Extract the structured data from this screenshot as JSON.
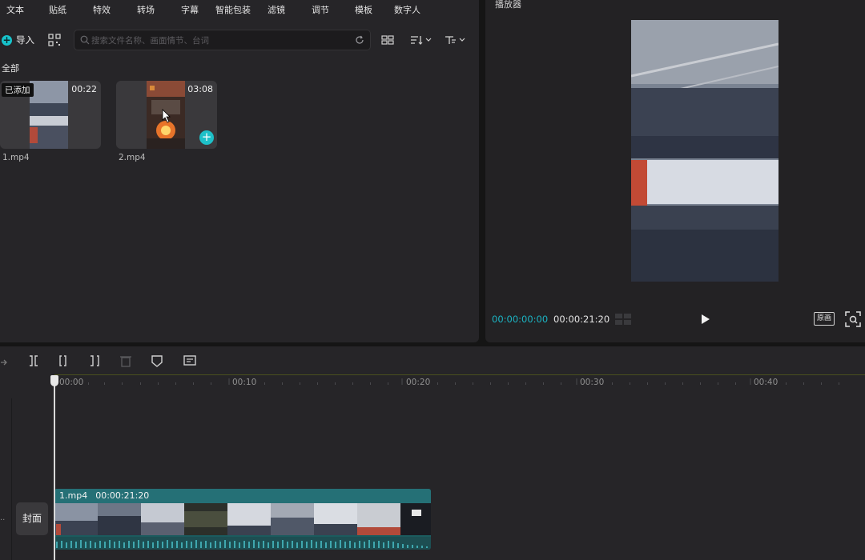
{
  "categories": [
    "文本",
    "贴纸",
    "特效",
    "转场",
    "字幕",
    "智能包装",
    "滤镜",
    "调节",
    "模板",
    "数字人"
  ],
  "media_panel": {
    "import_label": "导入",
    "search_placeholder": "搜索文件名称、画面情节、台词",
    "section_label": "全部",
    "items": [
      {
        "name": "1.mp4",
        "duration": "00:22",
        "badge": "已添加"
      },
      {
        "name": "2.mp4",
        "duration": "03:08",
        "badge": ""
      }
    ]
  },
  "player": {
    "title": "播放器",
    "current_time": "00:00:00:00",
    "total_time": "00:00:21:20",
    "ratio_label": "原画"
  },
  "timeline": {
    "ruler_labels": [
      "00:00",
      "00:10",
      "00:20",
      "00:30",
      "00:40"
    ],
    "cover_label": "封面",
    "clip": {
      "name": "1.mp4",
      "duration": "00:00:21:20"
    }
  },
  "colors": {
    "accent": "#1bb4c3",
    "clip_bg": "#1b5b5e",
    "panel_bg": "#262528"
  },
  "icons": [
    "qr-icon",
    "search-icon",
    "refresh-icon",
    "grid-view-icon",
    "sort-icon",
    "filter-icon",
    "play-icon",
    "fullscreen-icon",
    "split-icon",
    "split-left-icon",
    "split-right-icon",
    "delete-icon",
    "marker-icon",
    "subtitle-icon"
  ]
}
